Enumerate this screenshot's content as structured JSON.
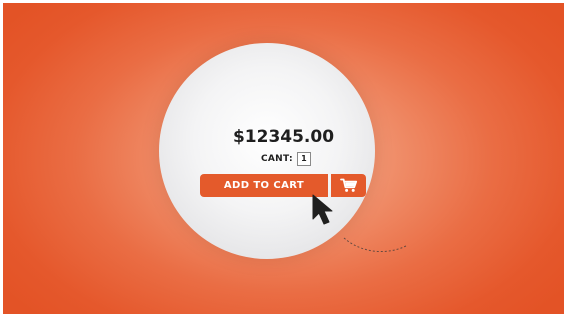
{
  "product": {
    "price": "$12345.00",
    "quantity_label": "CANT:",
    "quantity_value": "1"
  },
  "actions": {
    "add_to_cart_label": "ADD TO CART",
    "cart_icon": "shopping-cart-icon"
  },
  "pointer": {
    "icon": "arrow-cursor-icon"
  },
  "colors": {
    "accent": "#e45a2b",
    "background_outer": "#e35326",
    "background_inner": "#f6a987",
    "circle": "#f4f4f5",
    "text": "#1f1f1f"
  }
}
